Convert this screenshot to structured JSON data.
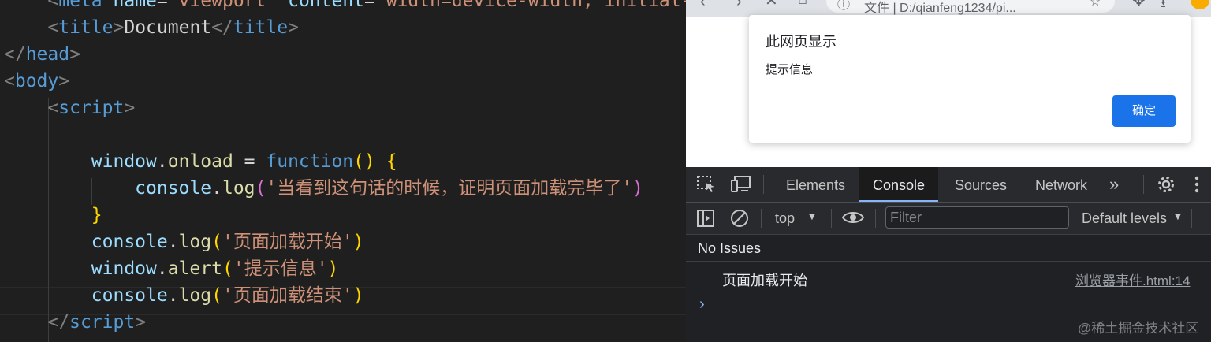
{
  "editor": {
    "lines": [
      [
        [
          "    ",
          "tk-text"
        ],
        [
          "<",
          "tk-br"
        ],
        [
          "meta",
          "tk-tag"
        ],
        [
          " ",
          "tk-text"
        ],
        [
          "name",
          "tk-attr"
        ],
        [
          "=",
          "tk-text"
        ],
        [
          "\"viewport\"",
          "tk-str"
        ],
        [
          " ",
          "tk-text"
        ],
        [
          "content",
          "tk-attr"
        ],
        [
          "=",
          "tk-text"
        ],
        [
          "\"width=device-width, initial-",
          "tk-str"
        ]
      ],
      [
        [
          "    ",
          "tk-text"
        ],
        [
          "<",
          "tk-br"
        ],
        [
          "title",
          "tk-tag"
        ],
        [
          ">",
          "tk-br"
        ],
        [
          "Document",
          "tk-text"
        ],
        [
          "</",
          "tk-br"
        ],
        [
          "title",
          "tk-tag"
        ],
        [
          ">",
          "tk-br"
        ]
      ],
      [
        [
          "</",
          "tk-br"
        ],
        [
          "head",
          "tk-tag"
        ],
        [
          ">",
          "tk-br"
        ]
      ],
      [
        [
          "<",
          "tk-br"
        ],
        [
          "body",
          "tk-tag"
        ],
        [
          ">",
          "tk-br"
        ]
      ],
      [
        [
          "    ",
          "tk-text"
        ],
        [
          "<",
          "tk-br"
        ],
        [
          "script",
          "tk-tag"
        ],
        [
          ">",
          "tk-br"
        ]
      ],
      [
        [
          "",
          "tk-text"
        ]
      ],
      [
        [
          "        ",
          "tk-text"
        ],
        [
          "window",
          "tk-var"
        ],
        [
          ".",
          "tk-punc"
        ],
        [
          "onload",
          "tk-fn"
        ],
        [
          " = ",
          "tk-punc"
        ],
        [
          "function",
          "tk-kw"
        ],
        [
          "()",
          "tk-b1"
        ],
        [
          " ",
          "tk-punc"
        ],
        [
          "{",
          "tk-b1"
        ]
      ],
      [
        [
          "            ",
          "tk-text"
        ],
        [
          "console",
          "tk-var"
        ],
        [
          ".",
          "tk-punc"
        ],
        [
          "log",
          "tk-fn"
        ],
        [
          "(",
          "tk-b2"
        ],
        [
          "'当看到这句话的时候，证明页面加载完毕了'",
          "tk-str"
        ],
        [
          ")",
          "tk-b2"
        ]
      ],
      [
        [
          "        ",
          "tk-text"
        ],
        [
          "}",
          "tk-b1"
        ]
      ],
      [
        [
          "        ",
          "tk-text"
        ],
        [
          "console",
          "tk-var"
        ],
        [
          ".",
          "tk-punc"
        ],
        [
          "log",
          "tk-fn"
        ],
        [
          "(",
          "tk-b1"
        ],
        [
          "'页面加载开始'",
          "tk-str"
        ],
        [
          ")",
          "tk-b1"
        ]
      ],
      [
        [
          "        ",
          "tk-text"
        ],
        [
          "window",
          "tk-var"
        ],
        [
          ".",
          "tk-punc"
        ],
        [
          "alert",
          "tk-fn"
        ],
        [
          "(",
          "tk-b1"
        ],
        [
          "'提示信息'",
          "tk-str"
        ],
        [
          ")",
          "tk-b1"
        ]
      ],
      [
        [
          "        ",
          "tk-text"
        ],
        [
          "console",
          "tk-var"
        ],
        [
          ".",
          "tk-punc"
        ],
        [
          "log",
          "tk-fn"
        ],
        [
          "(",
          "tk-b1"
        ],
        [
          "'页面加载结束'",
          "tk-str"
        ],
        [
          ")",
          "tk-b1"
        ]
      ],
      [
        [
          "    ",
          "tk-text"
        ],
        [
          "</",
          "tk-br"
        ],
        [
          "script",
          "tk-tag"
        ],
        [
          ">",
          "tk-br"
        ]
      ]
    ]
  },
  "browser": {
    "address_text": "文件 | D:/qianfeng1234/pi..."
  },
  "dialog": {
    "title": "此网页显示",
    "message": "提示信息",
    "ok_label": "确定"
  },
  "devtools": {
    "tabs": {
      "elements": "Elements",
      "console": "Console",
      "sources": "Sources",
      "network": "Network"
    },
    "toolbar": {
      "context": "top",
      "filter_placeholder": "Filter",
      "levels": "Default levels"
    },
    "issues": "No Issues",
    "log": {
      "message": "页面加载开始",
      "source": "浏览器事件.html:14"
    },
    "prompt": "›"
  },
  "watermark": "@稀土掘金技术社区",
  "colors": {
    "accent": "#1a73e8",
    "console_link": "#8ab4f8"
  }
}
